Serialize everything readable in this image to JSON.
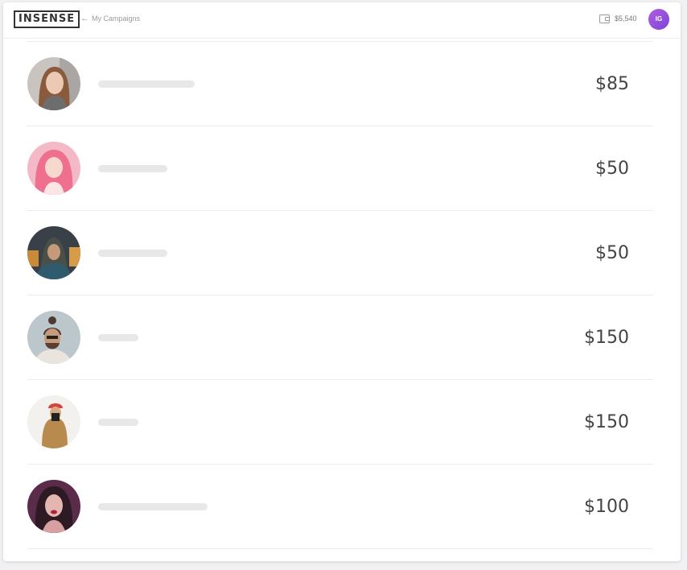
{
  "header": {
    "logo": "INSENSE",
    "back_arrow": "←",
    "back_label": "My Campaigns",
    "balance": "$5,540",
    "user_initials": "IG"
  },
  "creators": [
    {
      "price": "$85",
      "photo": "creator-photo-1"
    },
    {
      "price": "$50",
      "photo": "creator-photo-2"
    },
    {
      "price": "$50",
      "photo": "creator-photo-3"
    },
    {
      "price": "$150",
      "photo": "creator-photo-4"
    },
    {
      "price": "$150",
      "photo": "creator-photo-5"
    },
    {
      "price": "$100",
      "photo": "creator-photo-6"
    }
  ],
  "colors": {
    "accent": "#8e4fe0",
    "placeholder": "#e8e8e8",
    "price_text": "#444444"
  }
}
